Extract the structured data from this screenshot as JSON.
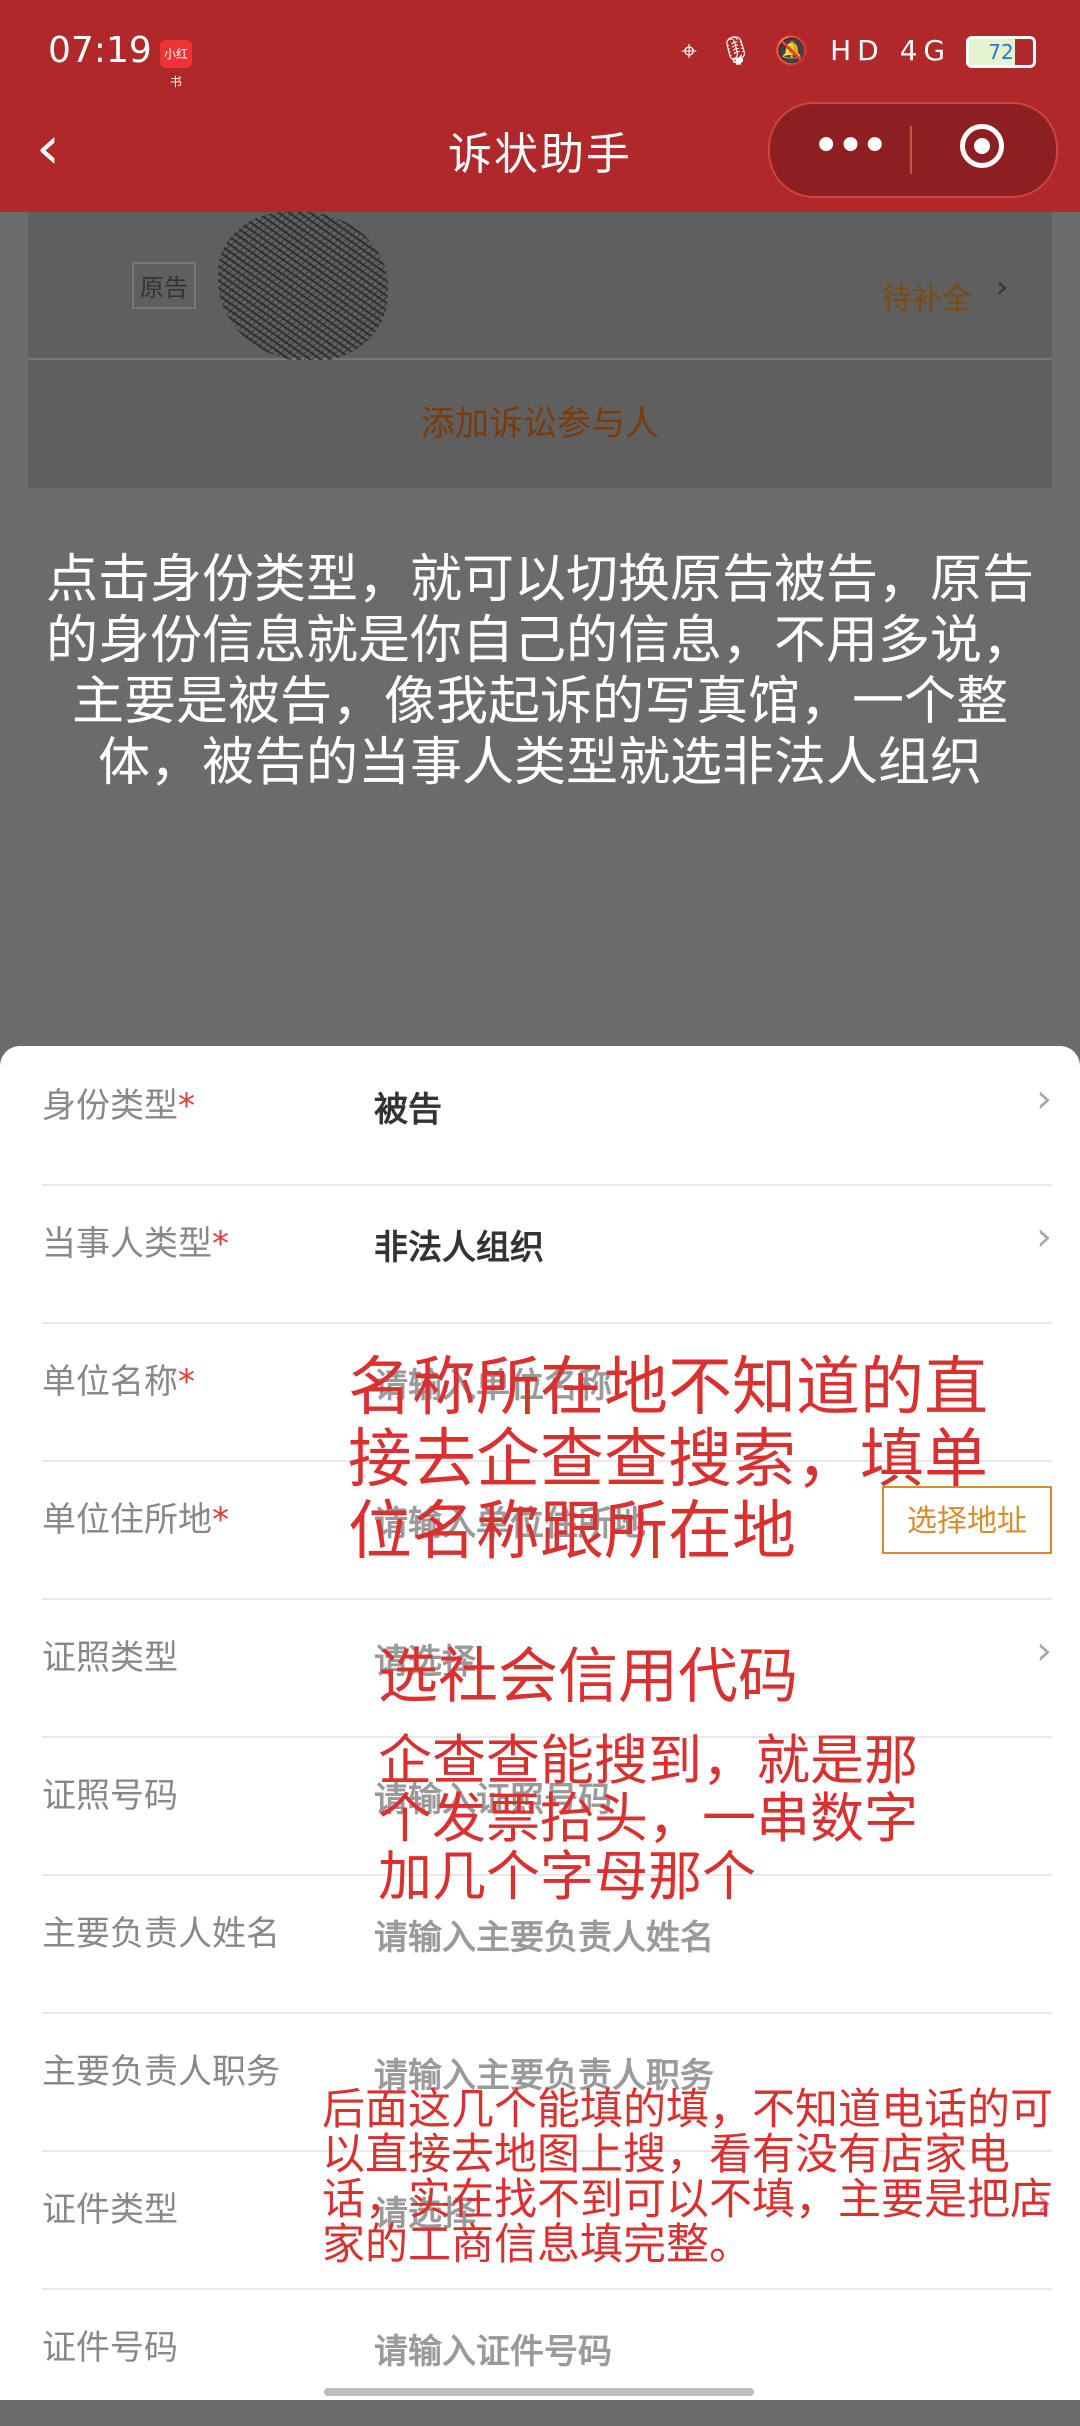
{
  "status_bar": {
    "time": "07:19",
    "app_badge": "小红书",
    "icons": "⌖ 🎙 🔕 HD 4G",
    "battery": "72"
  },
  "header": {
    "back_icon": "‹",
    "title": "诉状助手",
    "more_icon": "•••"
  },
  "background": {
    "plaintiff_tag": "原告",
    "pending_label": "待补全",
    "pending_chevron": "›",
    "add_participant": "添加诉讼参与人",
    "annotation": "点击身份类型，就可以切换原告被告，原告的身份信息就是你自己的信息，不用多说，主要是被告，像我起诉的写真馆，一个整体，被告的当事人类型就选非法人组织"
  },
  "form": {
    "rows": [
      {
        "label": "身份类型",
        "required": "*",
        "value": "被告",
        "chevron": "›"
      },
      {
        "label": "当事人类型",
        "required": "*",
        "value": "非法人组织",
        "chevron": "›"
      },
      {
        "label": "单位名称",
        "required": "*",
        "placeholder": "请输入单位名称"
      },
      {
        "label": "单位住所地",
        "required": "*",
        "placeholder": "请输入单位住所地",
        "button": "选择地址"
      },
      {
        "label": "证照类型",
        "placeholder": "请选择",
        "chevron": "›"
      },
      {
        "label": "证照号码",
        "placeholder": "请输入证照号码"
      },
      {
        "label": "主要负责人姓名",
        "placeholder": "请输入主要负责人姓名"
      },
      {
        "label": "主要负责人职务",
        "placeholder": "请输入主要负责人职务"
      },
      {
        "label": "证件类型",
        "placeholder": "请选择",
        "chevron": "›"
      },
      {
        "label": "证件号码",
        "placeholder": "请输入证件号码"
      }
    ]
  },
  "annotations": {
    "name_address": "名称所在地不知道的直接去企查查搜索，填单位名称跟所在地",
    "license_type": "选社会信用代码",
    "license_number": "企查查能搜到，就是那个发票抬头，一串数字加几个字母那个",
    "others": "后面这几个能填的填，不知道电话的可以直接去地图上搜，看有没有店家电话，实在找不到可以不填，主要是把店家的工商信息填完整。"
  }
}
